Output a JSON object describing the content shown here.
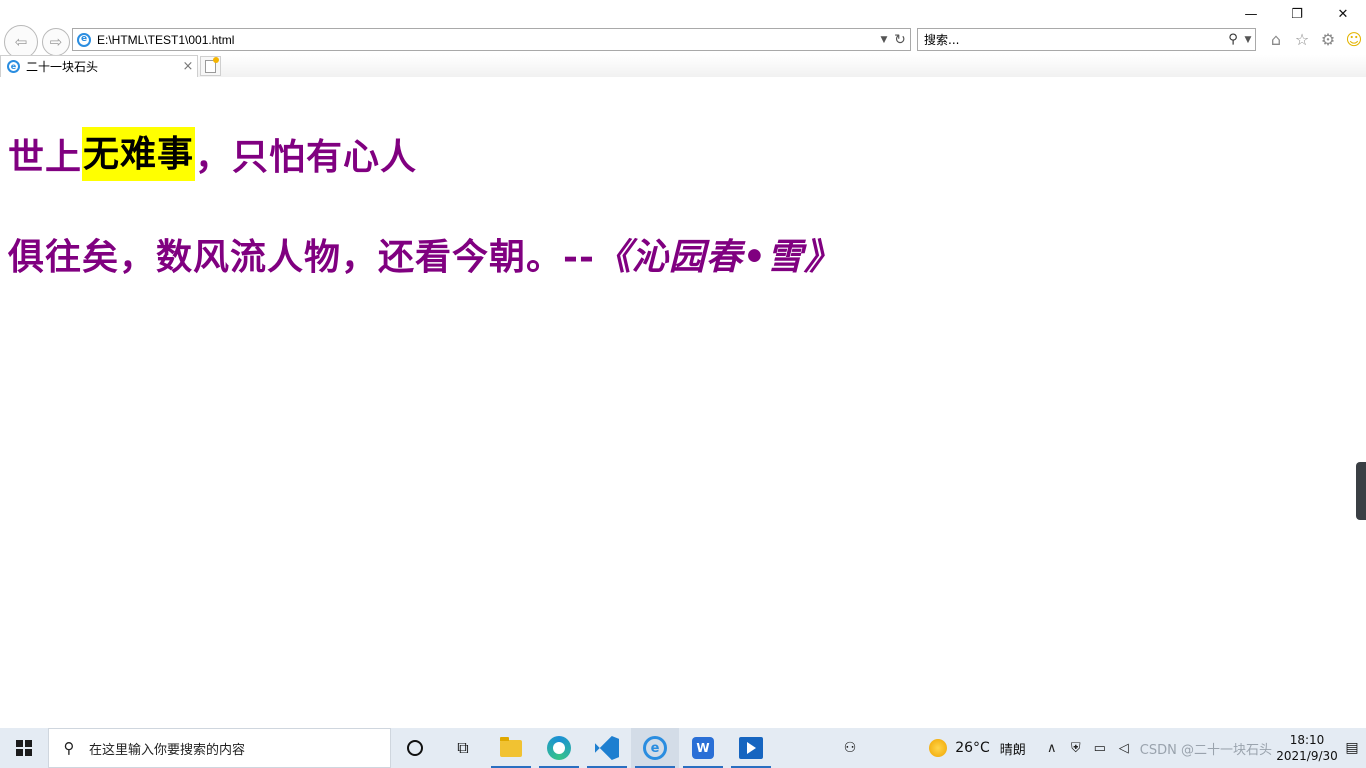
{
  "window": {
    "minimize_glyph": "—",
    "restore_glyph": "❐",
    "close_glyph": "✕"
  },
  "nav": {
    "back_glyph": "⇦",
    "forward_glyph": "⇨",
    "address": "E:\\HTML\\TEST1\\001.html",
    "search_placeholder": "搜索...",
    "home_icon": "home-icon",
    "favorites_icon": "star-icon",
    "settings_icon": "gear-icon",
    "feedback_icon": "smiley-icon"
  },
  "tab": {
    "title": "二十一块石头",
    "close_glyph": "×"
  },
  "content": {
    "line1_prefix": "世上",
    "line1_highlight": "无难事",
    "line1_suffix": "，只怕有心人",
    "line2_text": "俱往矣，数风流人物，还看今朝。--",
    "line2_title": "《沁园春•雪》",
    "text_color": "#800080",
    "highlight_color": "#ffff00"
  },
  "taskbar": {
    "search_placeholder": "在这里输入你要搜索的内容",
    "weather_temp": "26°C",
    "weather_desc": "晴朗",
    "watermark": "CSDN @二十一块石头",
    "time": "18:10",
    "date": "2021/9/30",
    "apps": [
      "file-explorer",
      "edge",
      "vscode",
      "internet-explorer",
      "wps",
      "media-player"
    ]
  }
}
